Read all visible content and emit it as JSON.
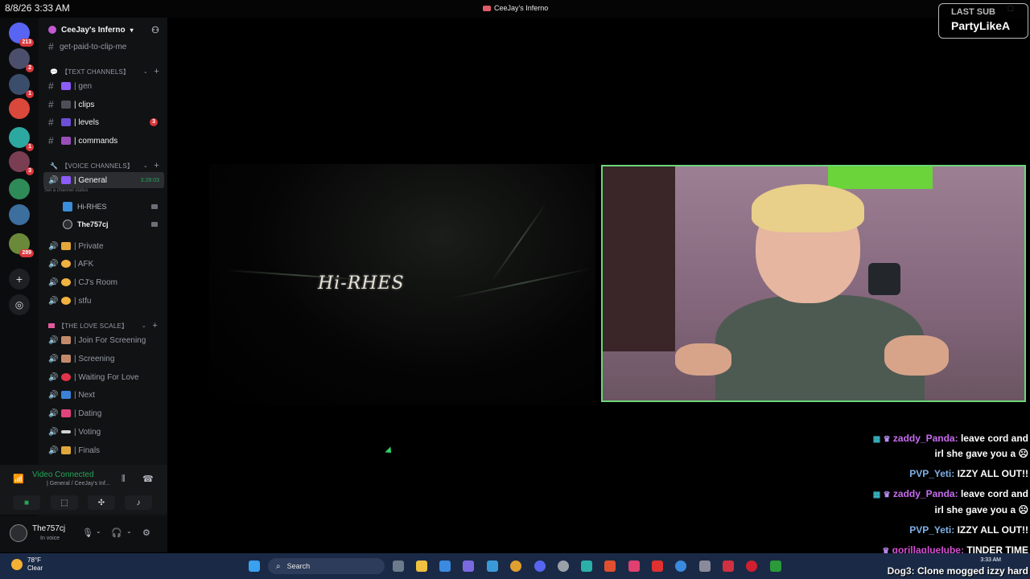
{
  "os": {
    "clock": "8/8/26 3:33 AM",
    "window_title": "CeeJay's Inferno",
    "taskbar": {
      "weather_temp": "78°F",
      "weather_cond": "Clear",
      "search_label": "Search",
      "time": "3:33 AM"
    }
  },
  "server_list": [
    {
      "name": "discord-home",
      "badge": "213",
      "color": "#5865f2"
    },
    {
      "name": "server-2",
      "badge": "2",
      "color": "#4b4f6b"
    },
    {
      "name": "server-3",
      "badge": "1",
      "color": "#3a4d6a"
    },
    {
      "name": "server-4",
      "badge": "",
      "color": "#d9483b"
    },
    {
      "name": "server-5",
      "badge": "1",
      "color": "#2ca8a0"
    },
    {
      "name": "server-6",
      "badge": "3",
      "color": "#7a3e52"
    },
    {
      "name": "server-7",
      "badge": "",
      "color": "#2e8b57"
    },
    {
      "name": "server-8",
      "badge": "",
      "color": "#3c6e9e"
    },
    {
      "name": "server-9",
      "badge": "289",
      "color": "#6a8a3a"
    }
  ],
  "guild": {
    "name": "CeeJay's Inferno",
    "top_channel": "get-paid-to-clip-me"
  },
  "text_category": "【TEXT CHANNELS】",
  "text_channels": [
    {
      "name": "| gen",
      "badge": ""
    },
    {
      "name": "| clips",
      "badge": ""
    },
    {
      "name": "| levels",
      "badge": "3"
    },
    {
      "name": "| commands",
      "badge": ""
    }
  ],
  "voice_category": "【VOICE CHANNELS】",
  "voice_general": {
    "name": "| General",
    "timer": "3:28:03",
    "status_placeholder": "Set a channel status"
  },
  "voice_members": [
    {
      "name": "Hi-RHES"
    },
    {
      "name": "The757cj"
    }
  ],
  "voice_channels": [
    {
      "name": "| Private"
    },
    {
      "name": "| AFK"
    },
    {
      "name": "| CJ's Room"
    },
    {
      "name": "| stfu"
    }
  ],
  "love_category": "【THE LOVE SCALE】",
  "love_channels": [
    {
      "name": "| Join For Screening"
    },
    {
      "name": "| Screening"
    },
    {
      "name": "| Waiting For Love"
    },
    {
      "name": "| Next"
    },
    {
      "name": "| Dating"
    },
    {
      "name": "| Voting"
    },
    {
      "name": "| Finals"
    }
  ],
  "voice_status": {
    "title": "Video Connected",
    "subtitle": "| General / CeeJay's Inf..."
  },
  "user": {
    "name": "The757cj",
    "status": "In voice"
  },
  "stream": {
    "video_title": "Hi-RHES",
    "last_sub_label": "LAST SUB",
    "last_sub_name": "PartyLikeA"
  },
  "chat": [
    {
      "user": "zaddy_Panda:",
      "msg": "leave cord and",
      "color": "#c86cf0"
    },
    {
      "user": "",
      "msg": "irl she gave you a ☹",
      "color": "#c86cf0"
    },
    {
      "user": "PVP_Yeti:",
      "msg": "IZZY ALL OUT!!",
      "color": "#7fb1e8"
    },
    {
      "user": "zaddy_Panda:",
      "msg": "leave cord and",
      "color": "#c86cf0"
    },
    {
      "user": "",
      "msg": "irl she gave you a ☹",
      "color": "#c86cf0"
    },
    {
      "user": "PVP_Yeti:",
      "msg": "IZZY ALL OUT!!",
      "color": "#7fb1e8"
    },
    {
      "user": "gorillaglueIube:",
      "msg": "TINDER TIME",
      "color": "#d64fd6"
    },
    {
      "user": "Dog3:",
      "msg": "Clone mogged izzy hard",
      "color": "#f0f0f0"
    }
  ]
}
